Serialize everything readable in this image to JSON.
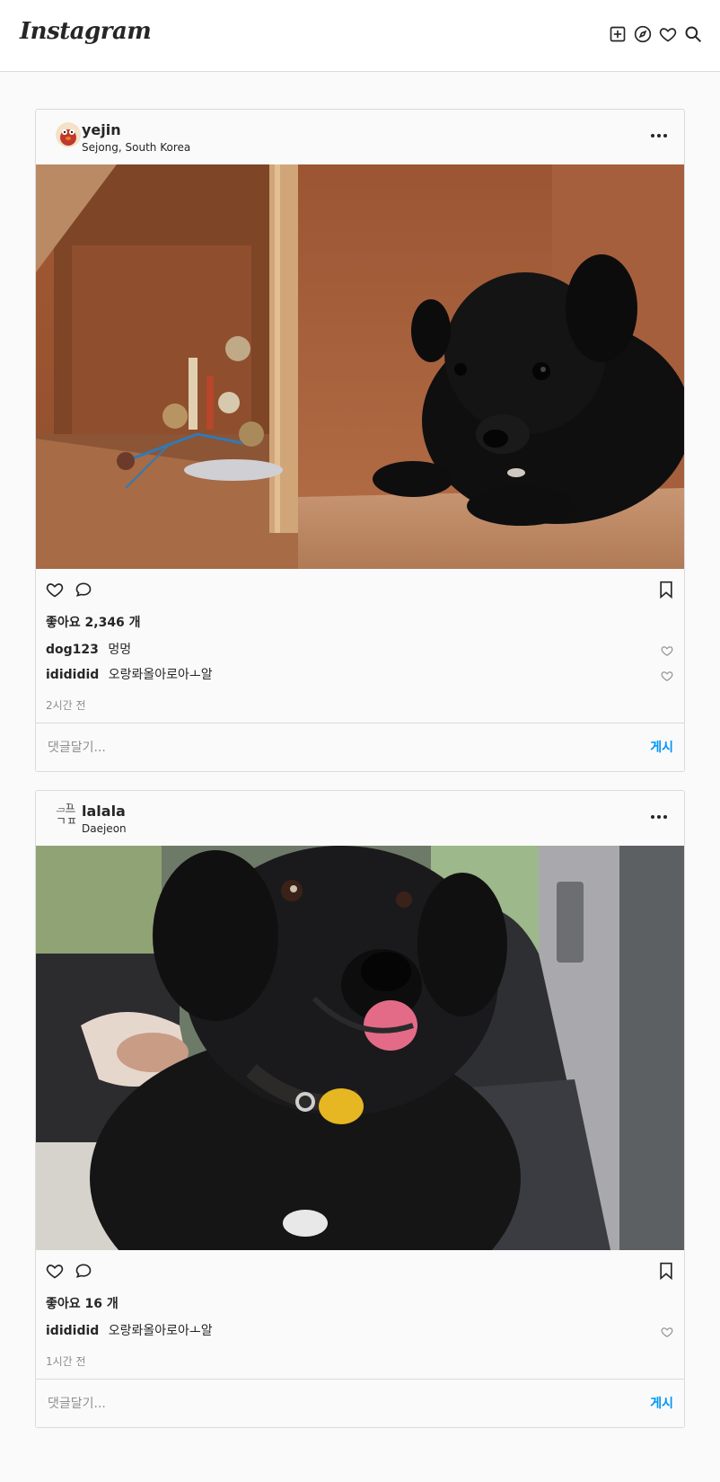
{
  "app": {
    "logo": "Instagram"
  },
  "nav": {
    "icons": [
      "new-post-icon",
      "explore-icon",
      "activity-heart-icon",
      "search-icon"
    ]
  },
  "posts": [
    {
      "username": "yejin",
      "location": "Sejong, South Korea",
      "likes": "좋아요 2,346 개",
      "comments": [
        {
          "user": "dog123",
          "text": "멍멍"
        },
        {
          "user": "idididid",
          "text": "오랑롸올아로아ㅗ알"
        }
      ],
      "time": "2시간 전",
      "photo_alt": "black puppy on wooden shelf"
    },
    {
      "username": "lalala",
      "location": "Daejeon",
      "avatar_alt": "프ㄱㅍ",
      "likes": "좋아요 16 개",
      "comments": [
        {
          "user": "idididid",
          "text": "오랑롸올아로아ㅗ알"
        }
      ],
      "time": "1시간 전",
      "photo_alt": "black dog in car seat"
    }
  ],
  "comment_box": {
    "placeholder": "댓글달기...",
    "post_label": "게시"
  },
  "colors": {
    "accent": "#0095f6",
    "border": "#dbdbdb",
    "background": "#fafafa"
  }
}
